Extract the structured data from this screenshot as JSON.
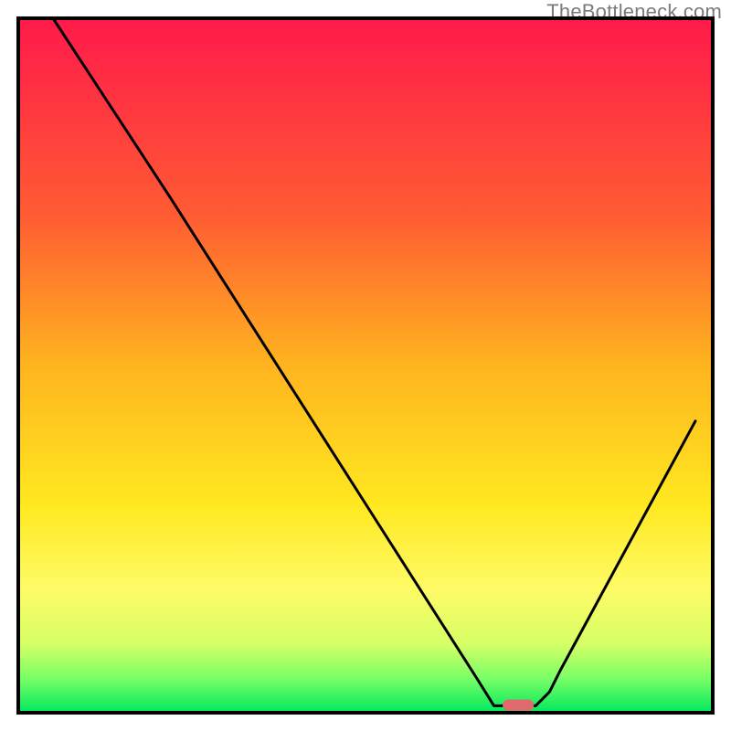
{
  "watermark": "TheBottleneck.com",
  "chart_data": {
    "type": "line",
    "title": "",
    "xlabel": "",
    "ylabel": "",
    "xlim": [
      0,
      100
    ],
    "ylim": [
      0,
      100
    ],
    "gradient_stops": [
      {
        "offset": 0.0,
        "color": "#ff1a4b"
      },
      {
        "offset": 0.28,
        "color": "#ff5a33"
      },
      {
        "offset": 0.5,
        "color": "#ffb41f"
      },
      {
        "offset": 0.7,
        "color": "#ffe820"
      },
      {
        "offset": 0.82,
        "color": "#fffb66"
      },
      {
        "offset": 0.9,
        "color": "#d7ff66"
      },
      {
        "offset": 0.95,
        "color": "#7bff66"
      },
      {
        "offset": 1.0,
        "color": "#00e85e"
      }
    ],
    "curve": {
      "x": [
        5.0,
        22.0,
        66.0,
        68.5,
        74.5,
        76.5,
        78.0,
        97.5
      ],
      "y": [
        100.0,
        74.0,
        5.0,
        1.0,
        1.0,
        3.0,
        6.0,
        42.0
      ]
    },
    "marker": {
      "x": 72.0,
      "y": 1.1,
      "w": 4.5,
      "h": 1.6,
      "color": "#e16a6f"
    },
    "frame": {
      "x": 2.5,
      "y": 2.5,
      "w": 95,
      "h": 95
    }
  }
}
